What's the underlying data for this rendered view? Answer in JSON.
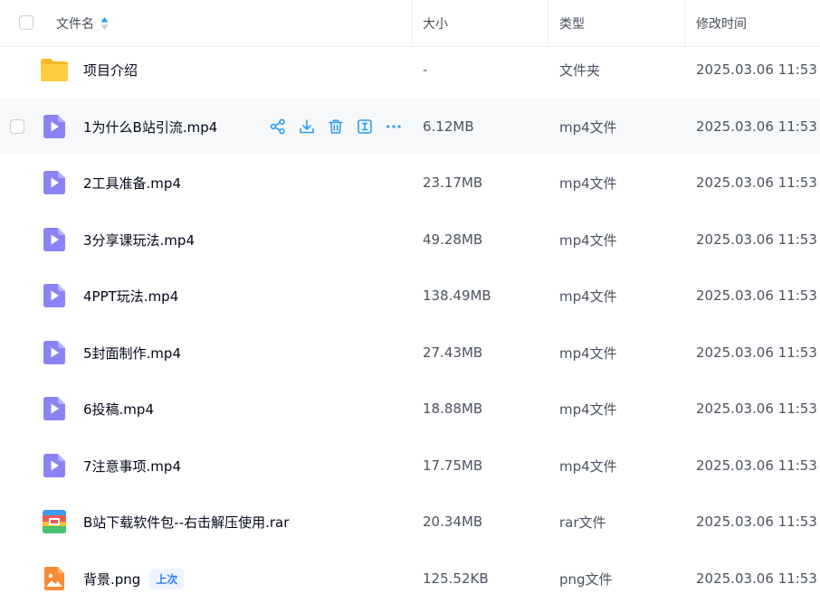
{
  "header": {
    "name_label": "文件名",
    "size_label": "大小",
    "type_label": "类型",
    "time_label": "修改时间"
  },
  "files": [
    {
      "name": "项目介绍",
      "size": "-",
      "type": "文件夹",
      "modified": "2025.03.06 11:53",
      "icon": "folder-icon"
    },
    {
      "name": "1为什么B站引流.mp4",
      "size": "6.12MB",
      "type": "mp4文件",
      "modified": "2025.03.06 11:53",
      "icon": "video-file-icon"
    },
    {
      "name": "2工具准备.mp4",
      "size": "23.17MB",
      "type": "mp4文件",
      "modified": "2025.03.06 11:53",
      "icon": "video-file-icon"
    },
    {
      "name": "3分享课玩法.mp4",
      "size": "49.28MB",
      "type": "mp4文件",
      "modified": "2025.03.06 11:53",
      "icon": "video-file-icon"
    },
    {
      "name": "4PPT玩法.mp4",
      "size": "138.49MB",
      "type": "mp4文件",
      "modified": "2025.03.06 11:53",
      "icon": "video-file-icon"
    },
    {
      "name": "5封面制作.mp4",
      "size": "27.43MB",
      "type": "mp4文件",
      "modified": "2025.03.06 11:53",
      "icon": "video-file-icon"
    },
    {
      "name": "6投稿.mp4",
      "size": "18.88MB",
      "type": "mp4文件",
      "modified": "2025.03.06 11:53",
      "icon": "video-file-icon"
    },
    {
      "name": "7注意事项.mp4",
      "size": "17.75MB",
      "type": "mp4文件",
      "modified": "2025.03.06 11:53",
      "icon": "video-file-icon"
    },
    {
      "name": "B站下载软件包--右击解压使用.rar",
      "size": "20.34MB",
      "type": "rar文件",
      "modified": "2025.03.06 11:53",
      "icon": "archive-file-icon"
    },
    {
      "name": "背景.png",
      "size": "125.52KB",
      "type": "png文件",
      "modified": "2025.03.06 11:53",
      "icon": "image-file-icon",
      "badge": "上次"
    }
  ],
  "hovered_row_actions": [
    "share-icon",
    "download-icon",
    "delete-icon",
    "rename-icon",
    "more-icon"
  ],
  "colors": {
    "accent": "#2a9df4",
    "video_icon": "#8b83f5",
    "folder_icon": "#fcc93a",
    "hover_row": "#f7f8fa"
  }
}
